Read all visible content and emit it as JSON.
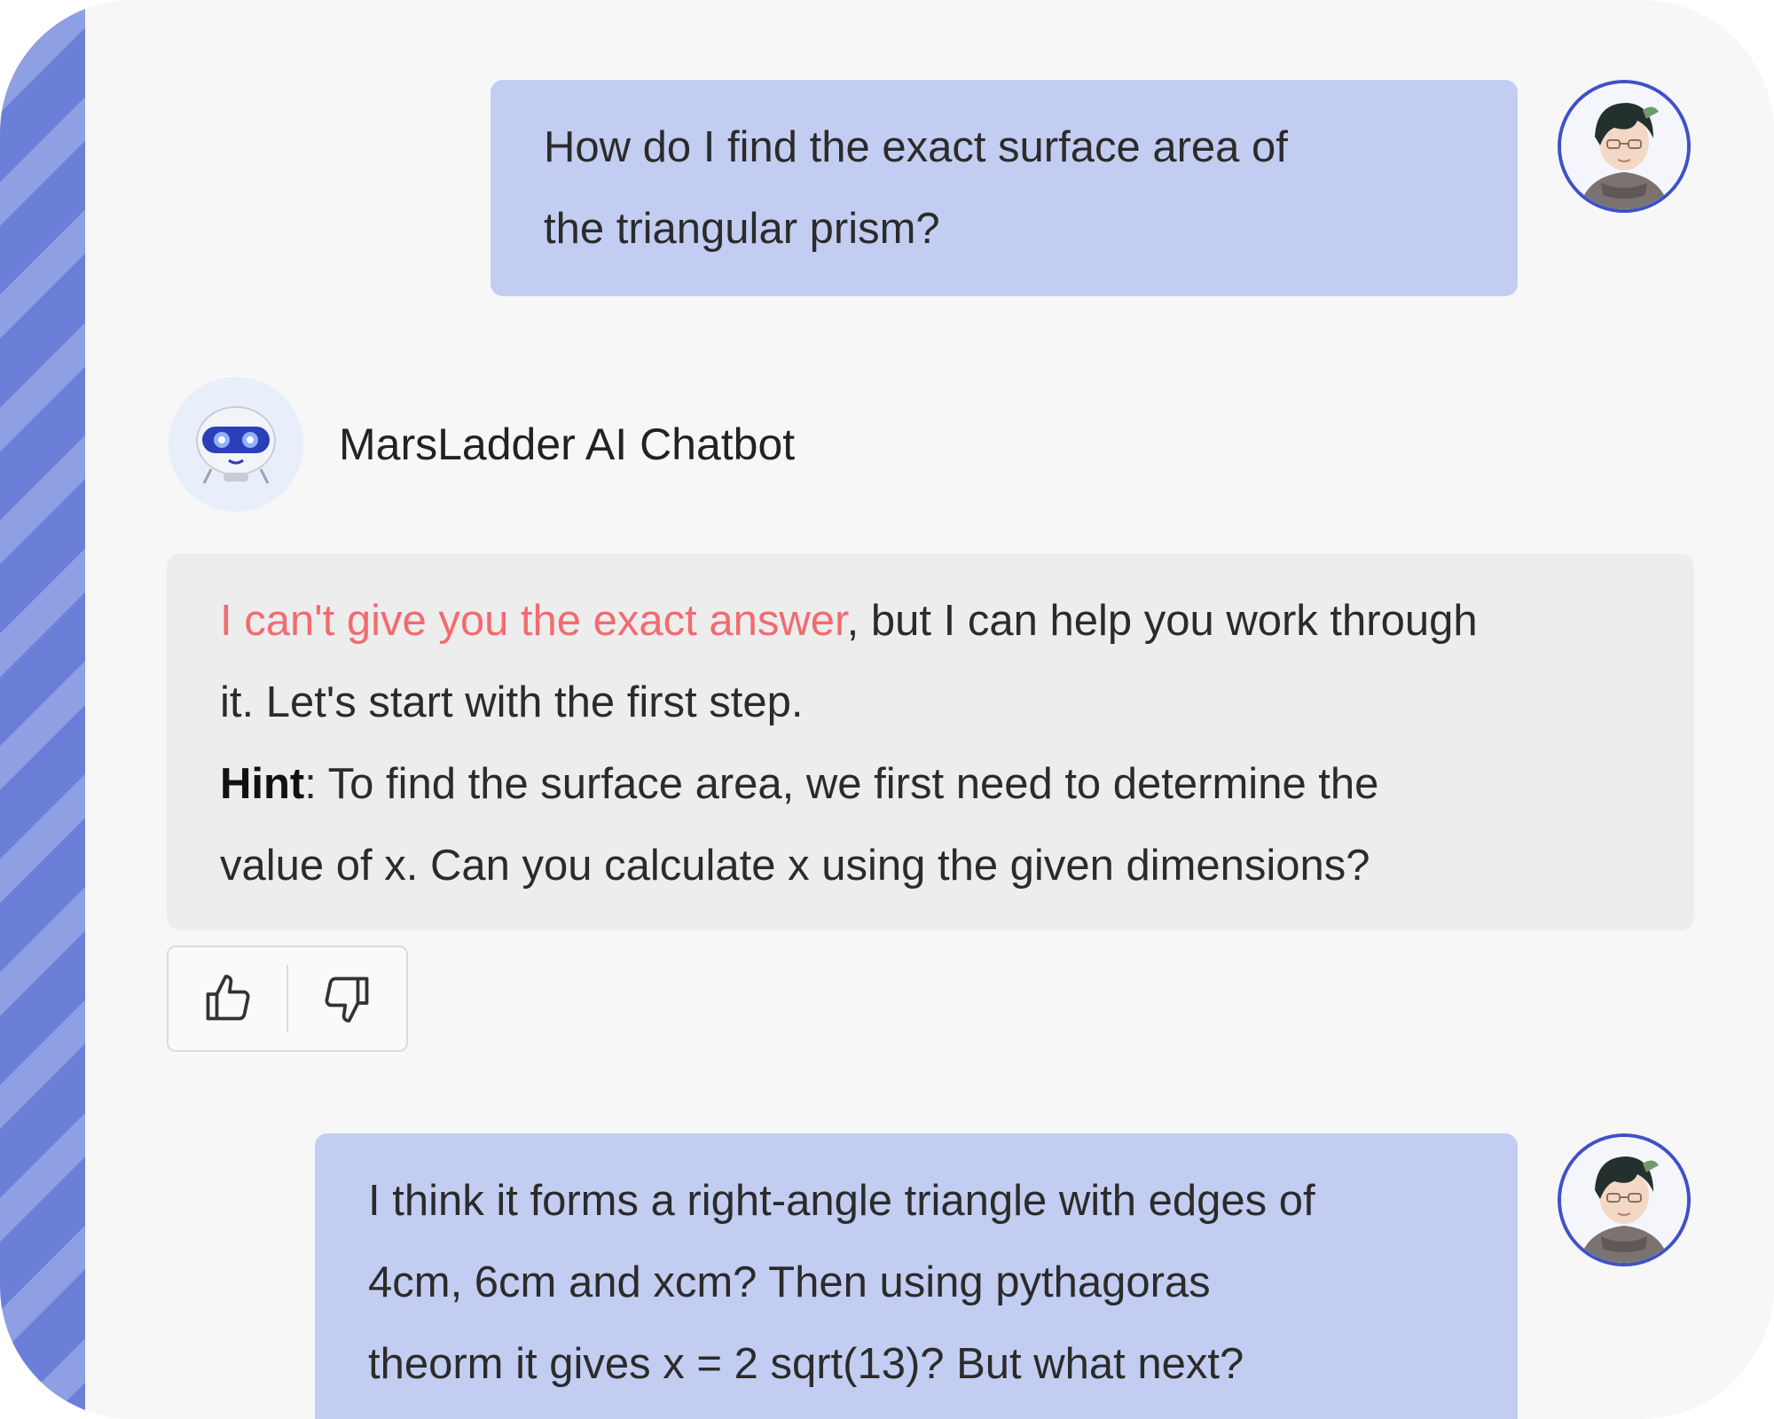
{
  "conversation": {
    "messages": [
      {
        "role": "user",
        "text_line1": "How do I find the exact surface area of",
        "text_line2": "the triangular prism?"
      },
      {
        "role": "assistant",
        "refusal": "I can't give you the exact answer",
        "after_refusal": ", but I can help you work through",
        "line2": "it. Let's start with the first step.",
        "hint_label": "Hint",
        "hint_text": ": To find the surface area, we first need to determine the",
        "line4": "value of x. Can you calculate x using the given dimensions?"
      },
      {
        "role": "user",
        "text_line1": "I think it forms a right-angle triangle with edges of",
        "text_line2": "4cm, 6cm and xcm? Then using pythagoras",
        "text_line3": "theorm it gives x = 2 sqrt(13)? But what next?"
      }
    ]
  },
  "bot": {
    "name": "MarsLadder AI Chatbot"
  },
  "feedback": {
    "like_icon": "thumbs-up-icon",
    "dislike_icon": "thumbs-down-icon"
  },
  "colors": {
    "user_bubble": "#c3cdf1",
    "bot_bubble": "#ededee",
    "refusal_text": "#f26b6f",
    "accent_stripe": "#6b7fd8",
    "avatar_border": "#3f51c8"
  }
}
